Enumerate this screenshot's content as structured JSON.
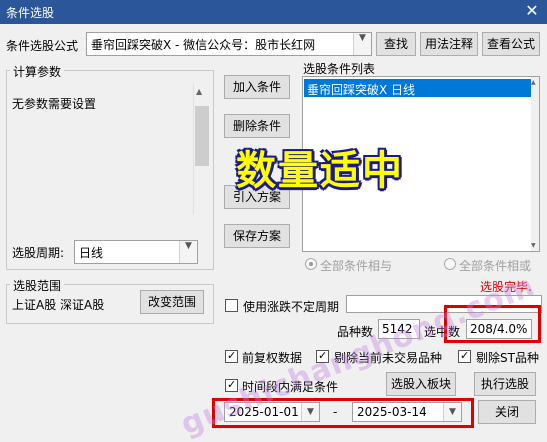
{
  "window": {
    "title": "条件选股",
    "close_glyph": "✕"
  },
  "formula": {
    "label": "条件选股公式",
    "value": "垂帘回踩突破X  -  微信公众号：股市长红网",
    "buttons": {
      "find": "查找",
      "usage": "用法注释",
      "view": "查看公式"
    }
  },
  "params": {
    "group_title": "计算参数",
    "text": "无参数需要设置"
  },
  "period": {
    "label": "选股周期:",
    "value": "日线"
  },
  "actions": {
    "add": "加入条件",
    "remove": "删除条件",
    "import": "引入方案",
    "save": "保存方案"
  },
  "conditions": {
    "title": "选股条件列表",
    "items": [
      "垂帘回踩突破X  日线"
    ]
  },
  "overlay_text": "数量适中",
  "logic": {
    "and": "全部条件相与",
    "or": "全部条件相或"
  },
  "status": "选股完毕.",
  "status_color": "#e00000",
  "range": {
    "group_title": "选股范围",
    "value": "上证A股 深证A股",
    "change_button": "改变范围"
  },
  "volatile_period": {
    "label": "使用涨跌不定周期",
    "checked": false
  },
  "counts": {
    "total_label": "品种数",
    "total": "5142",
    "selected_label": "选中数",
    "selected": "208/4.0%"
  },
  "options": {
    "adjust": {
      "label": "前复权数据",
      "checked": true
    },
    "exclude_untraded": {
      "label": "剔除当前未交易品种",
      "checked": true
    },
    "exclude_st": {
      "label": "剔除ST品种",
      "checked": true
    },
    "time_range": {
      "label": "时间段内满足条件",
      "checked": true
    }
  },
  "buttons": {
    "to_block": "选股入板块",
    "execute": "执行选股",
    "close": "关闭"
  },
  "dates": {
    "start": "2025-01-01",
    "separator": "-",
    "end": "2025-03-14"
  },
  "watermark": "gushichanghong.com",
  "highlight_color": "#e00000",
  "title_bar_color": "#2b579a",
  "selection_color": "#0078d7"
}
